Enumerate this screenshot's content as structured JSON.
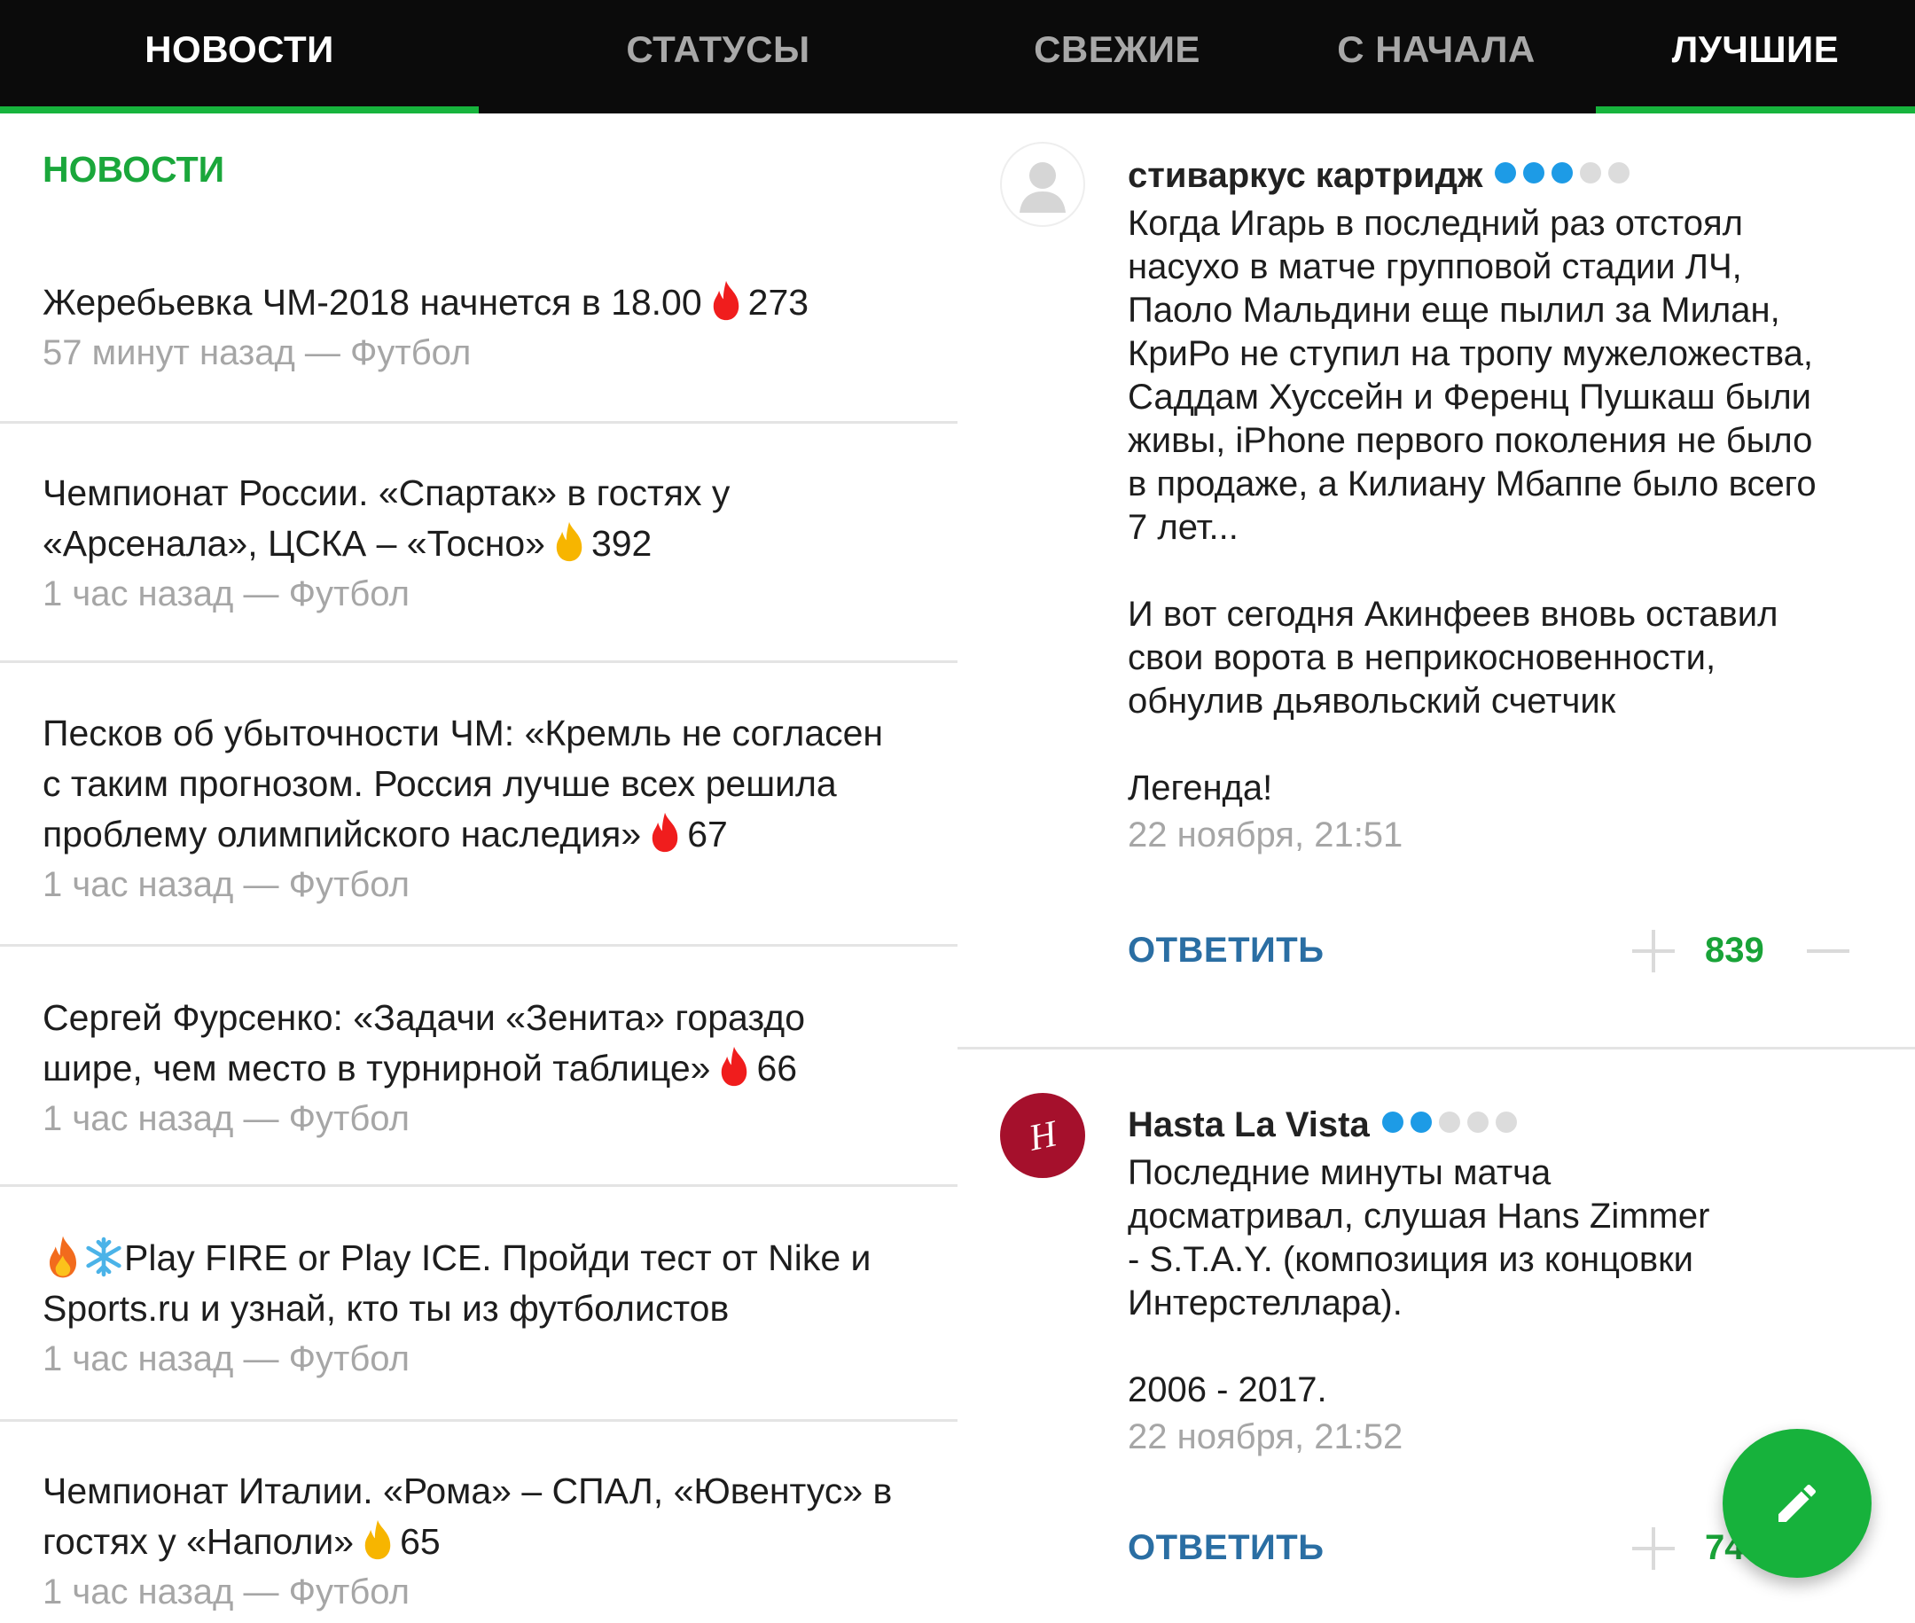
{
  "left_panel": {
    "tabs": [
      {
        "label": "НОВОСТИ",
        "active": true
      },
      {
        "label": "СТАТУСЫ",
        "active": false
      }
    ],
    "section_title": "НОВОСТИ",
    "news": [
      {
        "title": "Жеребьевка ЧМ-2018 начнется в 18.00",
        "icon": "fire-red-icon",
        "count": "273",
        "time": "57 минут назад",
        "category": "Футбол",
        "meta": "57 минут назад — Футбол"
      },
      {
        "title_line1": "Чемпионат России. «Спартак» в гостях у",
        "title_line2": "«Арсенала», ЦСКА – «Тосно»",
        "icon": "fire-yellow-icon",
        "count": "392",
        "meta": "1 час назад — Футбол"
      },
      {
        "title_line1": "Песков об убыточности ЧМ: «Кремль не согласен",
        "title_line2": "с таким прогнозом. Россия лучше всех решила",
        "title_line3": "проблему олимпийского наследия»",
        "icon": "fire-red-icon",
        "count": "67",
        "meta": "1 час назад — Футбол"
      },
      {
        "title_line1": "Сергей Фурсенко: «Задачи «Зенита» гораздо",
        "title_line2": "шире, чем место в турнирной таблице»",
        "icon": "fire-red-icon",
        "count": "66",
        "meta": "1 час назад — Футбол"
      },
      {
        "title_line1": "Play FIRE or Play ICE. Пройди тест от Nike и",
        "title_line2": "Sports.ru и узнай, кто ты из футболистов",
        "emojis": [
          "fire-emoji-icon",
          "snowflake-emoji-icon"
        ],
        "meta": "1 час назад — Футбол"
      },
      {
        "title_line1": "Чемпионат Италии. «Рома» – СПАЛ, «Ювентус» в",
        "title_line2": "гостях у «Наполи»",
        "icon": "fire-yellow-icon",
        "count": "65",
        "meta": "1 час назад — Футбол"
      }
    ]
  },
  "right_panel": {
    "tabs": [
      {
        "label": "СВЕЖИЕ",
        "active": false
      },
      {
        "label": "С НАЧАЛА",
        "active": false
      },
      {
        "label": "ЛУЧШИЕ",
        "active": true
      }
    ],
    "comments": [
      {
        "author": "стиваркус картридж",
        "rating_dots": 3,
        "text": "Когда Игарь в последний раз отстоял\nнасухо в матче групповой стадии ЛЧ,\nПаоло Мальдини еще пылил за Милан,\nКриРо не ступил на тропу мужеложества,\nСаддам Хуссейн и Ференц Пушкаш были\nживы, iPhone первого поколения не было\nв продаже, а Килиану Мбаппе было всего\n7 лет...\n\nИ вот сегодня Акинфеев вновь оставил\nсвои ворота в неприкосновенности,\nобнулив дьявольский счетчик\n\n Легенда!",
        "date": "22 ноября, 21:51",
        "reply_label": "ОТВЕТИТЬ",
        "score": "839"
      },
      {
        "author": "Hasta La Vista",
        "rating_dots": 2,
        "avatar_letter": "H",
        "text": "Последние минуты матча\nдосматривал, слушая Hans Zimmer\n- S.T.A.Y. (композиция из концовки\nИнтерстеллара).\n\n2006 - 2017.",
        "date": "22 ноября, 21:52",
        "reply_label": "ОТВЕТИТЬ",
        "score": "74"
      }
    ]
  },
  "colors": {
    "accent_green": "#17b43d",
    "tab_bar": "#0b0b0b",
    "rating_blue": "#1d9be6",
    "reply_blue": "#2a6ea3",
    "avatar_red": "#a5102c",
    "fire_red": "#f01d1d",
    "fire_yellow": "#f7b500"
  }
}
